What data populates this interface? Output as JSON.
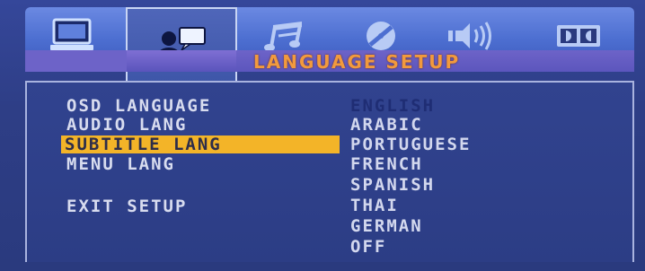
{
  "title": "LANGUAGE SETUP",
  "tabs": [
    {
      "icon": "monitor-icon"
    },
    {
      "icon": "person-speech-icon",
      "active": true
    },
    {
      "icon": "music-notes-icon"
    },
    {
      "icon": "disc-icon"
    },
    {
      "icon": "speaker-icon"
    },
    {
      "icon": "dolby-icon"
    }
  ],
  "menu": {
    "items": [
      {
        "label": "OSD LANGUAGE"
      },
      {
        "label": "AUDIO LANG"
      },
      {
        "label": "SUBTITLE LANG",
        "selected": true
      },
      {
        "label": "MENU LANG"
      },
      {
        "label": "EXIT SETUP"
      }
    ],
    "options": [
      {
        "label": "ENGLISH",
        "current": true
      },
      {
        "label": "ARABIC"
      },
      {
        "label": "PORTUGUESE"
      },
      {
        "label": "FRENCH"
      },
      {
        "label": "SPANISH"
      },
      {
        "label": "THAI"
      },
      {
        "label": "GERMAN"
      },
      {
        "label": "OFF"
      }
    ]
  },
  "colors": {
    "background": "#2c3f7e",
    "highlight": "#f3b428",
    "title": "#f29a3d",
    "text": "#d8dcef"
  }
}
